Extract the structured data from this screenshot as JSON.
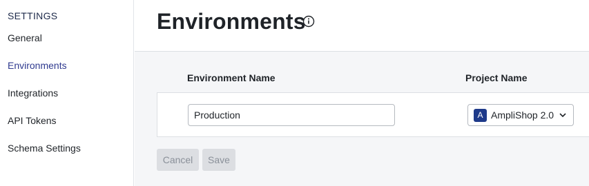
{
  "sidebar": {
    "heading": "SETTINGS",
    "items": [
      {
        "label": "General",
        "active": false
      },
      {
        "label": "Environments",
        "active": true
      },
      {
        "label": "Integrations",
        "active": false
      },
      {
        "label": "API Tokens",
        "active": false
      },
      {
        "label": "Schema Settings",
        "active": false
      }
    ]
  },
  "header": {
    "title": "Environments",
    "info_icon": "info-circle-icon"
  },
  "table": {
    "columns": [
      "Environment Name",
      "Project Name"
    ],
    "rows": [
      {
        "environment_name": "Production",
        "project": {
          "avatar_letter": "A",
          "name": "AmpliShop 2.0"
        }
      }
    ]
  },
  "actions": {
    "cancel_label": "Cancel",
    "save_label": "Save"
  },
  "colors": {
    "active_nav": "#2f3a8f",
    "project_avatar": "#1e3a8a",
    "content_background": "#f5f6f8",
    "disabled_button": "#dcdee2"
  }
}
